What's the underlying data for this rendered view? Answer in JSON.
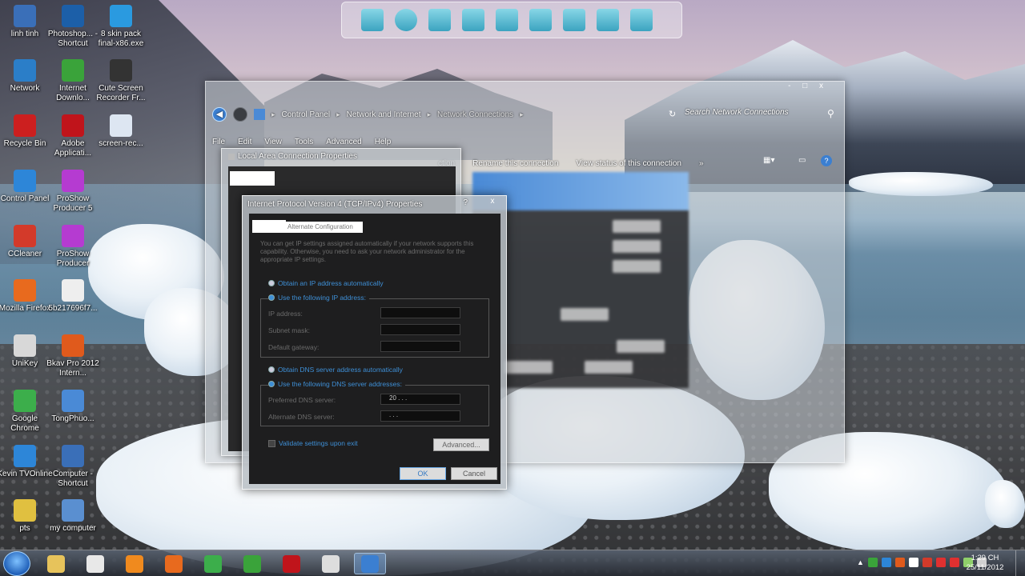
{
  "desktop": {
    "icons": [
      {
        "label": "linh tinh",
        "icon": "folder-icon",
        "color": "#3a6fb8"
      },
      {
        "label": "Photoshop... - Shortcut",
        "icon": "photoshop-icon",
        "color": "#1c5fa8"
      },
      {
        "label": "8 skin pack final-x86.exe",
        "icon": "windows-icon",
        "color": "#2a9ae0"
      },
      {
        "label": "Network",
        "icon": "network-icon",
        "color": "#2b7ec8"
      },
      {
        "label": "Internet Downlo...",
        "icon": "idm-icon",
        "color": "#3aa33a"
      },
      {
        "label": "Cute Screen Recorder Fr...",
        "icon": "film-reel-icon",
        "color": "#333333"
      },
      {
        "label": "Recycle Bin",
        "icon": "recycle-bin-icon",
        "color": "#cc1f1f"
      },
      {
        "label": "Adobe Applicati...",
        "icon": "adobe-icon",
        "color": "#c0141b"
      },
      {
        "label": "screen-rec...",
        "icon": "file-icon",
        "color": "#dde6f2"
      },
      {
        "label": "Control Panel",
        "icon": "control-panel-icon",
        "color": "#2d86d8"
      },
      {
        "label": "ProShow Producer 5",
        "icon": "proshow-icon",
        "color": "#b53bd1"
      },
      {
        "label": "CCleaner",
        "icon": "ccleaner-icon",
        "color": "#d33a2a"
      },
      {
        "label": "ProShow Producer",
        "icon": "proshow-icon",
        "color": "#b53bd1"
      },
      {
        "label": "Mozilla Firefox",
        "icon": "firefox-icon",
        "color": "#e86a1e"
      },
      {
        "label": "5b217696f7...",
        "icon": "file-icon",
        "color": "#eeeeee"
      },
      {
        "label": "UniKey",
        "icon": "unikey-icon",
        "color": "#d8d8d8"
      },
      {
        "label": "Bkav Pro 2012 Intern...",
        "icon": "bkav-icon",
        "color": "#e05a1c"
      },
      {
        "label": "Google Chrome",
        "icon": "chrome-icon",
        "color": "#3cae4b"
      },
      {
        "label": "TongPhuo...",
        "icon": "book-icon",
        "color": "#4a8ad6"
      },
      {
        "label": "Kevin TVOnline",
        "icon": "tv-icon",
        "color": "#2d86d8"
      },
      {
        "label": "Computer - Shortcut",
        "icon": "computer-icon",
        "color": "#3a6fb8"
      },
      {
        "label": "pts",
        "icon": "document-icon",
        "color": "#e0c040"
      },
      {
        "label": "my computer",
        "icon": "computer-icon",
        "color": "#5a8fd0"
      }
    ]
  },
  "explorer": {
    "window_controls": "- □ x",
    "breadcrumb": [
      "Control Panel",
      "Network and Internet",
      "Network Connections"
    ],
    "search_placeholder": "Search Network Connections",
    "menu": [
      "File",
      "Edit",
      "View",
      "Tools",
      "Advanced",
      "Help"
    ],
    "commands": [
      "ction",
      "Rename this connection",
      "View status of this connection",
      "»"
    ]
  },
  "lac_dialog": {
    "title": "Local Area Connection Properties"
  },
  "ipv4_dialog": {
    "title": "Internet Protocol Version 4 (TCP/IPv4) Properties",
    "help": "?",
    "close": "x",
    "tab_general": "",
    "tab_alt": "Alternate Configuration",
    "description": "You can get IP settings assigned automatically if your network supports this capability. Otherwise, you need to ask your network administrator for the appropriate IP settings.",
    "ip_auto": "Obtain an IP address automatically",
    "ip_manual": "Use the following IP address:",
    "ip_label": "IP address:",
    "subnet_label": "Subnet mask:",
    "gateway_label": "Default gateway:",
    "dns_auto": "Obtain DNS server address automatically",
    "dns_manual": "Use the following DNS server addresses:",
    "preferred_dns_label": "Preferred DNS server:",
    "preferred_dns_value": "20 .   .   .",
    "alternate_dns_label": "Alternate DNS server:",
    "alternate_dns_value": " .   .   .",
    "validate": "Validate settings upon exit",
    "advanced": "Advanced...",
    "ok": "OK",
    "cancel": "Cancel"
  },
  "taskbar": {
    "items": [
      "explorer-folder-icon",
      "unikey-icon",
      "media-player-icon",
      "firefox-icon",
      "chrome-icon",
      "idm-icon",
      "adobe-icon",
      "film-reel-icon",
      "network-connections-icon"
    ],
    "clock_time": "1:29 CH",
    "clock_date": "25/11/2012"
  }
}
